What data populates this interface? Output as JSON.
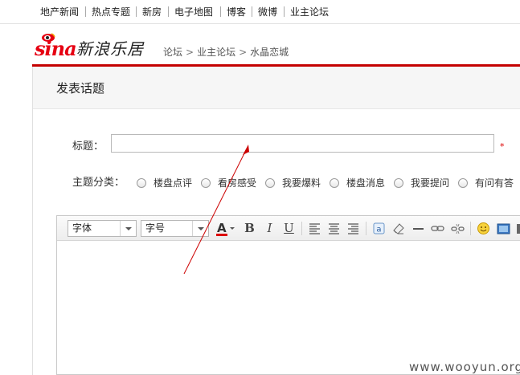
{
  "top_nav": {
    "links": [
      "地产新闻",
      "热点专题",
      "新房",
      "电子地图",
      "博客",
      "微博",
      "业主论坛"
    ]
  },
  "logo": {
    "brand_latin": "sina",
    "brand_cn": "新浪乐居"
  },
  "breadcrumb": {
    "items": [
      "论坛",
      "业主论坛",
      "水晶恋城"
    ],
    "separator": ">"
  },
  "section": {
    "title": "发表话题"
  },
  "form": {
    "title_label": "标题：",
    "title_value": "",
    "required_mark": "*",
    "category_label": "主题分类：",
    "categories": [
      "楼盘点评",
      "看房感受",
      "我要爆料",
      "楼盘消息",
      "我要提问",
      "有问有答"
    ]
  },
  "editor": {
    "font_select": "字体",
    "size_select": "字号",
    "buttons": [
      "font-color",
      "bold",
      "italic",
      "underline",
      "align-left",
      "align-center",
      "align-right",
      "insert-at",
      "clear-format",
      "horizontal-rule",
      "insert-link",
      "remove-link",
      "emoticon",
      "insert-image",
      "more"
    ],
    "bold_label": "B",
    "italic_label": "I",
    "underline_label": "U",
    "font_color_label": "A",
    "content": ""
  },
  "colors": {
    "brand_red": "#e60012",
    "accent_line": "#c40000",
    "annotation_arrow": "#cc0000"
  },
  "watermark": "www.wooyun.org"
}
